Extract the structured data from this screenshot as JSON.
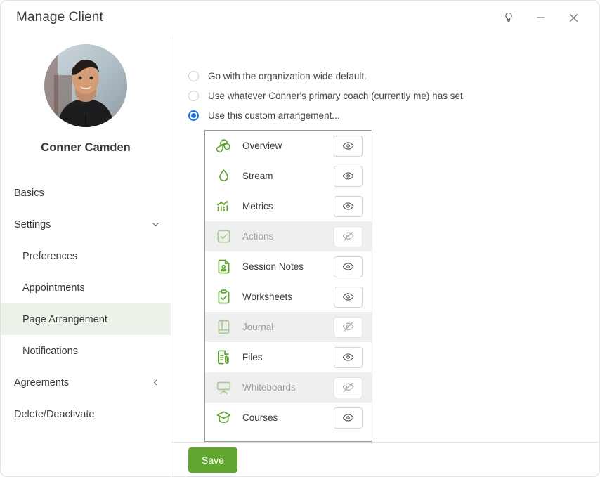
{
  "window": {
    "title": "Manage Client",
    "controls": [
      {
        "name": "lightbulb-icon",
        "label": "Tips"
      },
      {
        "name": "minimize-icon",
        "label": "Minimize"
      },
      {
        "name": "close-icon",
        "label": "Close"
      }
    ]
  },
  "sidebar": {
    "client_name": "Conner Camden",
    "avatar_alt": "Conner Camden profile photo",
    "items": [
      {
        "label": "Basics",
        "sub": false,
        "active": false,
        "chevron": ""
      },
      {
        "label": "Settings",
        "sub": false,
        "active": false,
        "chevron": "down"
      },
      {
        "label": "Preferences",
        "sub": true,
        "active": false,
        "chevron": ""
      },
      {
        "label": "Appointments",
        "sub": true,
        "active": false,
        "chevron": ""
      },
      {
        "label": "Page Arrangement",
        "sub": true,
        "active": true,
        "chevron": ""
      },
      {
        "label": "Notifications",
        "sub": true,
        "active": false,
        "chevron": ""
      },
      {
        "label": "Agreements",
        "sub": false,
        "active": false,
        "chevron": "left"
      },
      {
        "label": "Delete/Deactivate",
        "sub": false,
        "active": false,
        "chevron": ""
      }
    ]
  },
  "main": {
    "options": [
      {
        "label": "Go with the organization-wide default.",
        "selected": false
      },
      {
        "label": "Use whatever Conner's primary coach (currently me) has set",
        "selected": false
      },
      {
        "label": "Use this custom arrangement...",
        "selected": true
      }
    ],
    "pages": [
      {
        "label": "Overview",
        "icon": "leaves-circle-icon",
        "visible": true
      },
      {
        "label": "Stream",
        "icon": "water-drop-icon",
        "visible": true
      },
      {
        "label": "Metrics",
        "icon": "bar-chart-icon",
        "visible": true
      },
      {
        "label": "Actions",
        "icon": "check-square-icon",
        "visible": false
      },
      {
        "label": "Session Notes",
        "icon": "document-person-icon",
        "visible": true
      },
      {
        "label": "Worksheets",
        "icon": "clipboard-check-icon",
        "visible": true
      },
      {
        "label": "Journal",
        "icon": "book-icon",
        "visible": false
      },
      {
        "label": "Files",
        "icon": "file-attachment-icon",
        "visible": true
      },
      {
        "label": "Whiteboards",
        "icon": "whiteboard-icon",
        "visible": false
      },
      {
        "label": "Courses",
        "icon": "graduation-cap-icon",
        "visible": true
      }
    ],
    "eye_visible_name": "eye-icon",
    "eye_hidden_name": "eye-off-icon"
  },
  "footer": {
    "save_label": "Save"
  },
  "colors": {
    "accent_green": "#63a62f",
    "icon_green": "#5ba32b",
    "radio_blue": "#1a73e8",
    "active_nav_bg": "#ecf2e8",
    "disabled_row_bg": "#efefef"
  }
}
